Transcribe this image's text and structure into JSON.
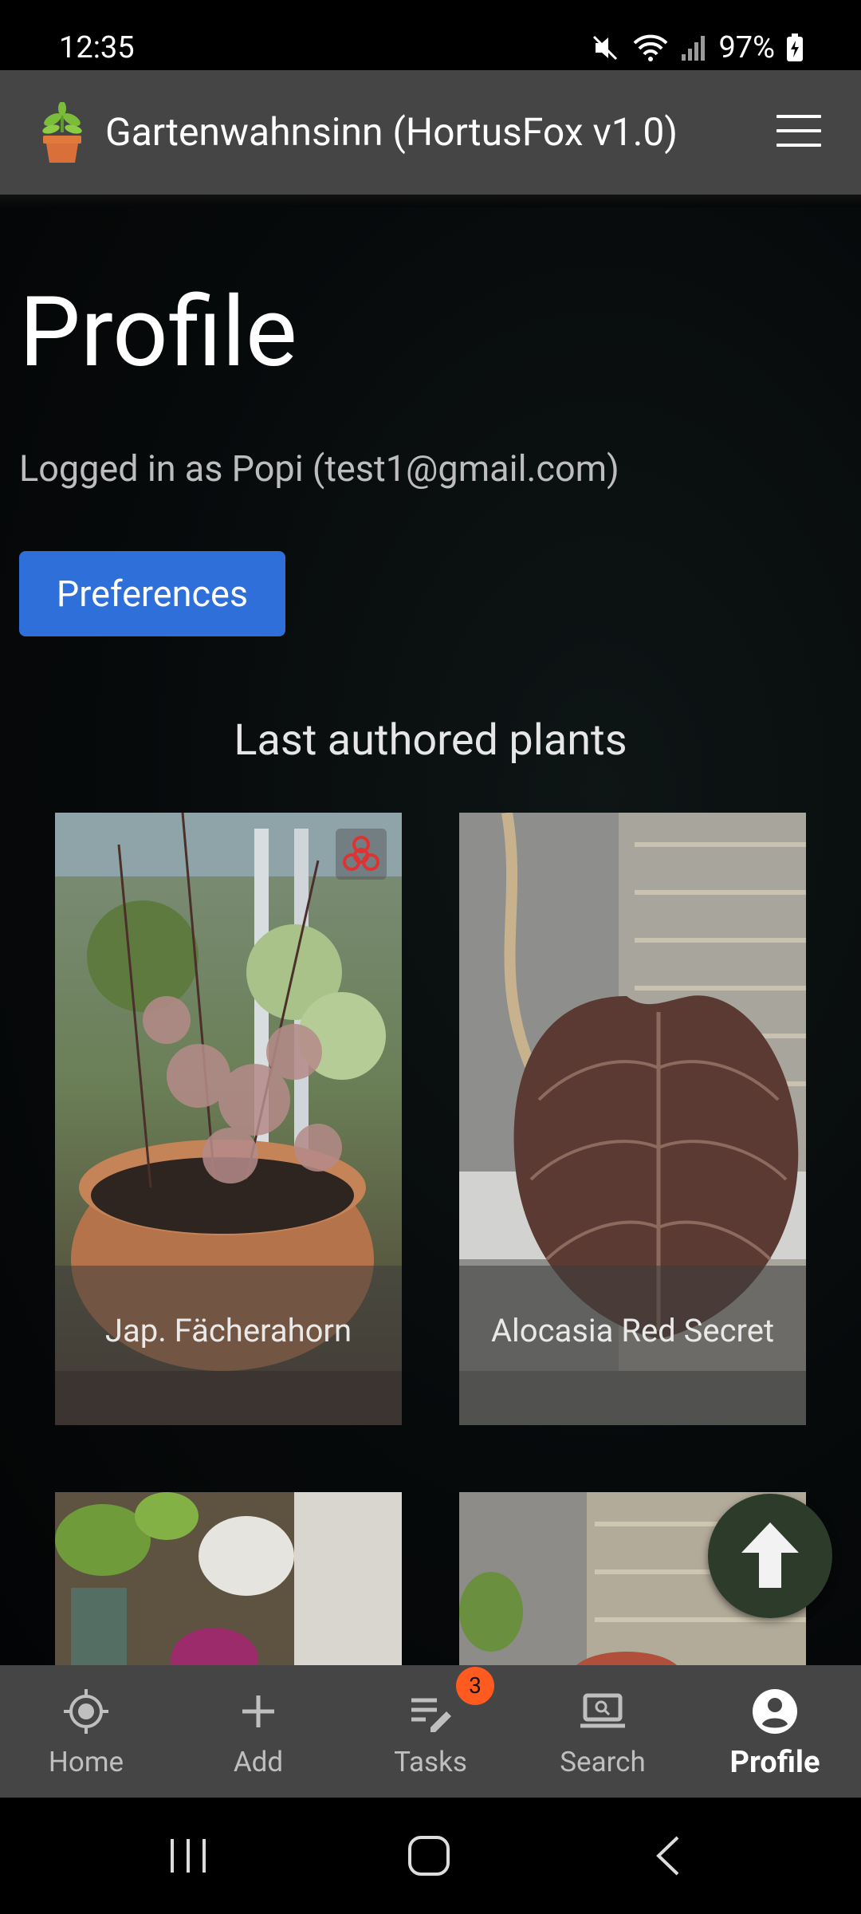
{
  "status_bar": {
    "time": "12:35",
    "battery_text": "97%",
    "icons": [
      "mute-icon",
      "wifi-icon",
      "signal-icon",
      "battery-icon"
    ]
  },
  "header": {
    "title": "Gartenwahnsinn (HortusFox v1.0)",
    "logo_icon": "potted-plant-icon",
    "menu_icon": "hamburger-icon"
  },
  "page": {
    "title": "Profile",
    "logged_in_text": "Logged in as Popi (test1@gmail.com)",
    "preferences_label": "Preferences",
    "section_title": "Last authored plants"
  },
  "plants": [
    {
      "name": "Jap. Fächerahorn",
      "badge_icon": "biohazard-icon"
    },
    {
      "name": "Alocasia Red Secret"
    },
    {
      "name": ""
    },
    {
      "name": ""
    }
  ],
  "fab": {
    "icon": "arrow-up-icon"
  },
  "bottom_nav": {
    "items": [
      {
        "label": "Home",
        "icon": "target-icon"
      },
      {
        "label": "Add",
        "icon": "plus-icon"
      },
      {
        "label": "Tasks",
        "icon": "tasks-icon",
        "badge": "3"
      },
      {
        "label": "Search",
        "icon": "laptop-search-icon"
      },
      {
        "label": "Profile",
        "icon": "user-circle-icon",
        "active": true
      }
    ]
  },
  "colors": {
    "accent": "#2f6fd9",
    "bar": "#454545",
    "badge": "#ff5a1f",
    "fab": "#2d3b2b"
  }
}
